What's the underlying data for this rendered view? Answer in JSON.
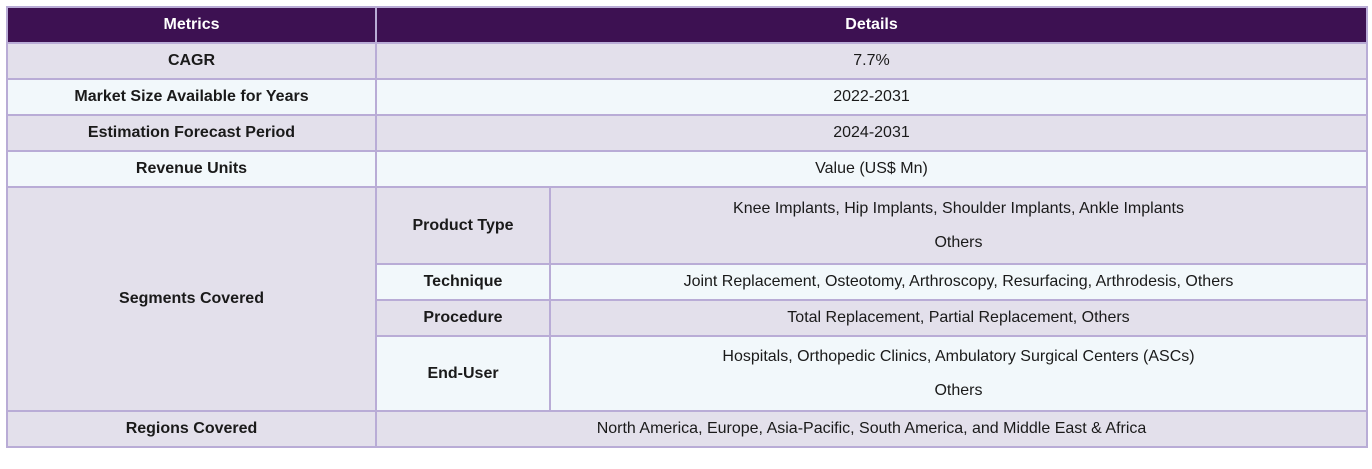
{
  "header": {
    "col1": "Metrics",
    "col2": "Details"
  },
  "rows": {
    "cagr": {
      "label": "CAGR",
      "value": "7.7%"
    },
    "market_size": {
      "label": "Market Size Available for Years",
      "value": "2022-2031"
    },
    "forecast": {
      "label": "Estimation Forecast Period",
      "value": "2024-2031"
    },
    "revenue": {
      "label": "Revenue Units",
      "value": "Value (US$ Mn)"
    },
    "segments": {
      "label": "Segments Covered",
      "product_type": {
        "label": "Product Type",
        "line1": "Knee Implants, Hip Implants, Shoulder Implants, Ankle Implants",
        "line2": "Others"
      },
      "technique": {
        "label": "Technique",
        "value": "Joint Replacement, Osteotomy, Arthroscopy, Resurfacing, Arthrodesis, Others"
      },
      "procedure": {
        "label": "Procedure",
        "value": "Total Replacement, Partial Replacement, Others"
      },
      "end_user": {
        "label": "End-User",
        "line1": "Hospitals, Orthopedic Clinics, Ambulatory Surgical Centers (ASCs)",
        "line2": "Others"
      }
    },
    "regions": {
      "label": "Regions Covered",
      "value": "North America, Europe, Asia-Pacific, South America, and Middle East & Africa"
    }
  }
}
